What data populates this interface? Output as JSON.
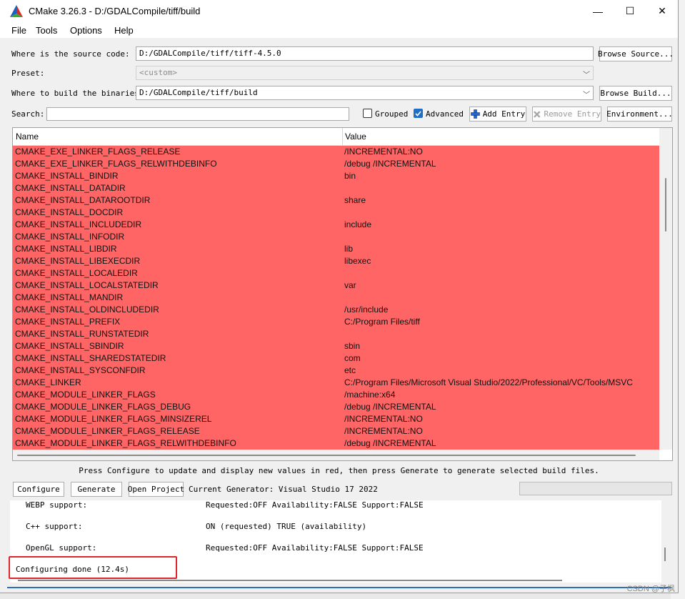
{
  "window": {
    "title": "CMake 3.26.3 - D:/GDALCompile/tiff/build"
  },
  "window_controls": {
    "minimize": "—",
    "maximize": "☐",
    "close": "✕"
  },
  "menu": [
    "File",
    "Tools",
    "Options",
    "Help"
  ],
  "source": {
    "label": "Where is the source code:",
    "value": "D:/GDALCompile/tiff/tiff-4.5.0",
    "browse": "Browse Source..."
  },
  "preset": {
    "label": "Preset:",
    "value": "<custom>"
  },
  "build": {
    "label": "Where to build the binaries:",
    "value": "D:/GDALCompile/tiff/build",
    "browse": "Browse Build..."
  },
  "search": {
    "label": "Search:",
    "value": ""
  },
  "options": {
    "grouped": "Grouped",
    "grouped_checked": false,
    "advanced": "Advanced",
    "advanced_checked": true
  },
  "entry_buttons": {
    "add": "Add Entry",
    "remove": "Remove Entry",
    "environment": "Environment..."
  },
  "table": {
    "columns": [
      "Name",
      "Value"
    ],
    "row_color": "#ff6565",
    "rows": [
      {
        "name": "CMAKE_EXE_LINKER_FLAGS_RELEASE",
        "value": "/INCREMENTAL:NO"
      },
      {
        "name": "CMAKE_EXE_LINKER_FLAGS_RELWITHDEBINFO",
        "value": "/debug /INCREMENTAL"
      },
      {
        "name": "CMAKE_INSTALL_BINDIR",
        "value": "bin"
      },
      {
        "name": "CMAKE_INSTALL_DATADIR",
        "value": ""
      },
      {
        "name": "CMAKE_INSTALL_DATAROOTDIR",
        "value": "share"
      },
      {
        "name": "CMAKE_INSTALL_DOCDIR",
        "value": ""
      },
      {
        "name": "CMAKE_INSTALL_INCLUDEDIR",
        "value": "include"
      },
      {
        "name": "CMAKE_INSTALL_INFODIR",
        "value": ""
      },
      {
        "name": "CMAKE_INSTALL_LIBDIR",
        "value": "lib"
      },
      {
        "name": "CMAKE_INSTALL_LIBEXECDIR",
        "value": "libexec"
      },
      {
        "name": "CMAKE_INSTALL_LOCALEDIR",
        "value": ""
      },
      {
        "name": "CMAKE_INSTALL_LOCALSTATEDIR",
        "value": "var"
      },
      {
        "name": "CMAKE_INSTALL_MANDIR",
        "value": ""
      },
      {
        "name": "CMAKE_INSTALL_OLDINCLUDEDIR",
        "value": "/usr/include"
      },
      {
        "name": "CMAKE_INSTALL_PREFIX",
        "value": "C:/Program Files/tiff"
      },
      {
        "name": "CMAKE_INSTALL_RUNSTATEDIR",
        "value": ""
      },
      {
        "name": "CMAKE_INSTALL_SBINDIR",
        "value": "sbin"
      },
      {
        "name": "CMAKE_INSTALL_SHAREDSTATEDIR",
        "value": "com"
      },
      {
        "name": "CMAKE_INSTALL_SYSCONFDIR",
        "value": "etc"
      },
      {
        "name": "CMAKE_LINKER",
        "value": "C:/Program Files/Microsoft Visual Studio/2022/Professional/VC/Tools/MSVC"
      },
      {
        "name": "CMAKE_MODULE_LINKER_FLAGS",
        "value": "/machine:x64"
      },
      {
        "name": "CMAKE_MODULE_LINKER_FLAGS_DEBUG",
        "value": "/debug /INCREMENTAL"
      },
      {
        "name": "CMAKE_MODULE_LINKER_FLAGS_MINSIZEREL",
        "value": "/INCREMENTAL:NO"
      },
      {
        "name": "CMAKE_MODULE_LINKER_FLAGS_RELEASE",
        "value": "/INCREMENTAL:NO"
      },
      {
        "name": "CMAKE_MODULE_LINKER_FLAGS_RELWITHDEBINFO",
        "value": "/debug /INCREMENTAL"
      }
    ]
  },
  "hint": "Press Configure to update and display new values in red, then press Generate to generate selected build files.",
  "actions": {
    "configure": "Configure",
    "generate": "Generate",
    "open_project": "Open Project",
    "generator": "Current Generator: Visual Studio 17 2022"
  },
  "output": {
    "lines": [
      {
        "label": "WEBP support:",
        "value": "Requested:OFF Availability:FALSE Support:FALSE"
      },
      {
        "label": "C++ support:",
        "value": "ON (requested) TRUE (availability)"
      },
      {
        "label": "OpenGL support:",
        "value": "Requested:OFF Availability:FALSE Support:FALSE"
      }
    ],
    "final": "Configuring done (12.4s)"
  },
  "watermark": "CSDN @子枫"
}
